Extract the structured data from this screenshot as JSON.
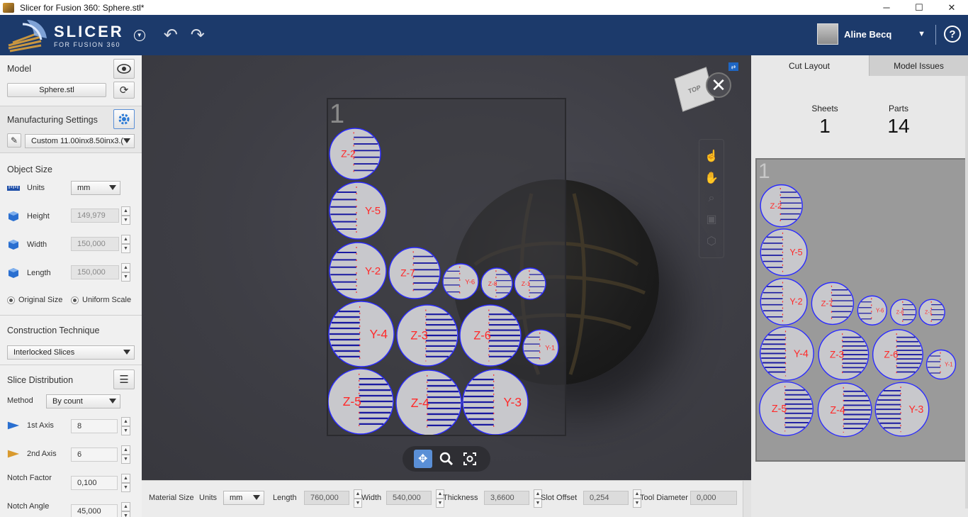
{
  "window": {
    "title": "Slicer for Fusion 360: Sphere.stl*",
    "controls": [
      "─",
      "☐",
      "✕"
    ]
  },
  "header": {
    "logo_big": "SLICER",
    "logo_small": "FOR FUSION 360",
    "user_name": "Aline Becq",
    "help": "?"
  },
  "model": {
    "title": "Model",
    "file": "Sphere.stl"
  },
  "manufacturing": {
    "title": "Manufacturing Settings",
    "preset": "Custom 11.00inx8.50inx3.("
  },
  "object_size": {
    "title": "Object Size",
    "units_label": "Units",
    "units_value": "mm",
    "height_label": "Height",
    "height_value": "149,979",
    "width_label": "Width",
    "width_value": "150,000",
    "length_label": "Length",
    "length_value": "150,000",
    "original_size": "Original Size",
    "uniform_scale": "Uniform Scale"
  },
  "construction": {
    "title": "Construction Technique",
    "value": "Interlocked Slices"
  },
  "distribution": {
    "title": "Slice Distribution",
    "method_label": "Method",
    "method_value": "By count",
    "axis1_label": "1st Axis",
    "axis1_value": "8",
    "axis2_label": "2nd Axis",
    "axis2_value": "6",
    "notch_factor_label": "Notch Factor",
    "notch_factor_value": "0,100",
    "notch_angle_label": "Notch Angle",
    "notch_angle_value": "45,000"
  },
  "bottom_bar": {
    "material_size": "Material Size",
    "units_label": "Units",
    "units_value": "mm",
    "length_label": "Length",
    "length_value": "760,000",
    "width_label": "Width",
    "width_value": "540,000",
    "thickness_label": "Thickness",
    "thickness_value": "3,6600",
    "slot_offset_label": "Slot Offset",
    "slot_offset_value": "0,254",
    "tool_diameter_label": "Tool Diameter",
    "tool_diameter_value": "0,000"
  },
  "viewport": {
    "sheet_number": "1",
    "viewcube_label": "TOP"
  },
  "right_panel": {
    "tab_cut_layout": "Cut Layout",
    "tab_model_issues": "Model Issues",
    "sheets_label": "Sheets",
    "sheets_value": "1",
    "parts_label": "Parts",
    "parts_value": "14",
    "sheet_number": "1"
  },
  "parts": [
    {
      "label": "Z-2",
      "size": "m"
    },
    {
      "label": "Y-5",
      "size": "m"
    },
    {
      "label": "Y-2",
      "size": "m"
    },
    {
      "label": "Z-7",
      "size": "m"
    },
    {
      "label": "Y-6",
      "size": "s"
    },
    {
      "label": "Z-8",
      "size": "s"
    },
    {
      "label": "Z-1",
      "size": "s"
    },
    {
      "label": "Y-4",
      "size": "l"
    },
    {
      "label": "Z-3",
      "size": "l"
    },
    {
      "label": "Z-6",
      "size": "l"
    },
    {
      "label": "Y-1",
      "size": "s"
    },
    {
      "label": "Z-5",
      "size": "l"
    },
    {
      "label": "Z-4",
      "size": "l"
    },
    {
      "label": "Y-3",
      "size": "l"
    }
  ],
  "colors": {
    "header": "#1c3a6b",
    "part_fill": "#c8c8cc",
    "part_stroke": "#2a2aff",
    "slot": "#1a1aa0",
    "label": "#ff2a2a"
  }
}
